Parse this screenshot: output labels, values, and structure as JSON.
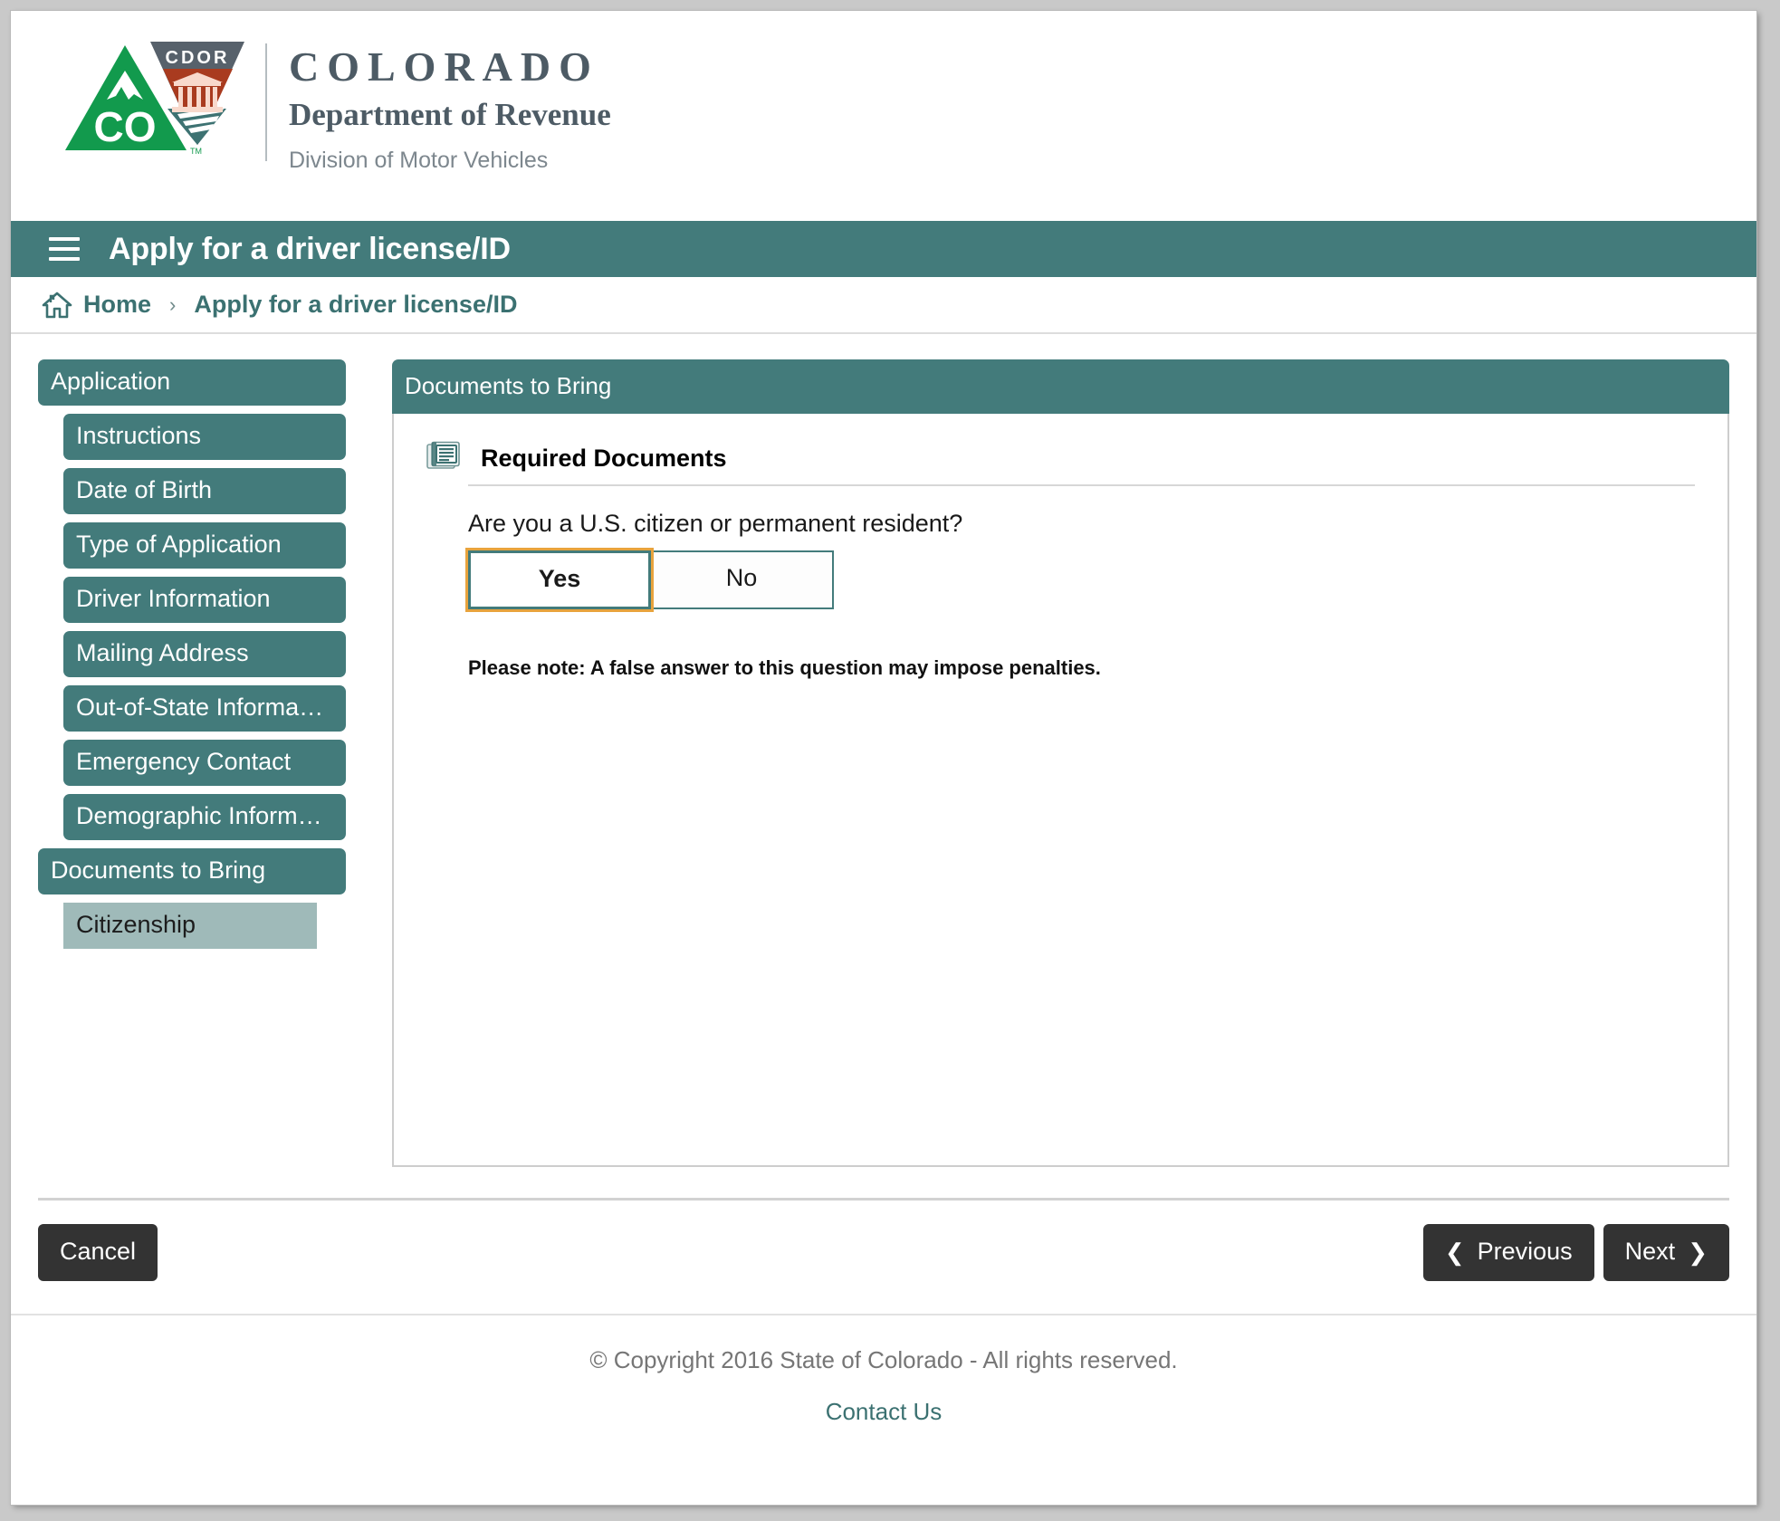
{
  "brand": {
    "logo_alt": "colorado-cdor-logo",
    "line1": "COLORADO",
    "line2": "Department of Revenue",
    "line3": "Division of Motor Vehicles"
  },
  "app_bar": {
    "menu_icon": "hamburger-menu-icon",
    "title": "Apply for a driver license/ID"
  },
  "breadcrumb": {
    "home_icon": "home-icon",
    "home_label": "Home",
    "separator": "›",
    "current": "Apply for a driver license/ID"
  },
  "sidebar": {
    "items": [
      {
        "label": "Application",
        "level": 0,
        "active": false
      },
      {
        "label": "Instructions",
        "level": 1,
        "active": false
      },
      {
        "label": "Date of Birth",
        "level": 1,
        "active": false
      },
      {
        "label": "Type of Application",
        "level": 1,
        "active": false
      },
      {
        "label": "Driver Information",
        "level": 1,
        "active": false
      },
      {
        "label": "Mailing Address",
        "level": 1,
        "active": false
      },
      {
        "label": "Out-of-State Informa…",
        "level": 1,
        "active": false
      },
      {
        "label": "Emergency Contact",
        "level": 1,
        "active": false
      },
      {
        "label": "Demographic Inform…",
        "level": 1,
        "active": false
      },
      {
        "label": "Documents to Bring",
        "level": 0,
        "active": false
      },
      {
        "label": "Citizenship",
        "level": 1,
        "active": true
      }
    ]
  },
  "panel": {
    "header": "Documents to Bring",
    "section_icon": "document-list-icon",
    "section_title": "Required Documents",
    "question": "Are you a U.S. citizen or permanent resident?",
    "choices": [
      {
        "label": "Yes",
        "selected": true
      },
      {
        "label": "No",
        "selected": false
      }
    ],
    "note": "Please note: A false answer to this question may impose penalties."
  },
  "actions": {
    "cancel_label": "Cancel",
    "previous_label": "Previous",
    "previous_icon": "chevron-left-icon",
    "next_label": "Next",
    "next_icon": "chevron-right-icon"
  },
  "footer": {
    "copyright": "© Copyright 2016 State of Colorado - All rights reserved.",
    "contact_label": "Contact Us"
  },
  "colors": {
    "teal": "#437b7b",
    "teal_text": "#3b7171",
    "active_nav": "#9fbab9",
    "focus_orange": "#e8a33d",
    "dark_button": "#333333",
    "logo_green": "#129a4d",
    "logo_gray": "#57616b",
    "logo_red": "#a93b1f"
  }
}
